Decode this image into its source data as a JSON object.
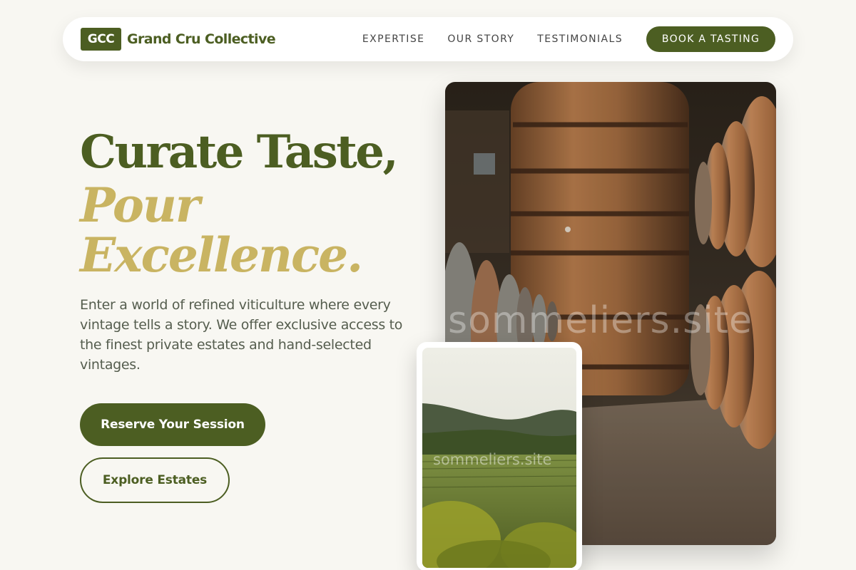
{
  "brand": {
    "badge": "GCC",
    "name": "Grand Cru Collective",
    "color": "#4c5e22",
    "accent": "#c9b462"
  },
  "nav": {
    "links": [
      "EXPERTISE",
      "OUR STORY",
      "TESTIMONIALS"
    ],
    "cta": "BOOK A TASTING"
  },
  "hero": {
    "line1": "Curate Taste,",
    "line2": "Pour",
    "line3": "Excellence.",
    "description": "Enter a world of refined viticulture where every vintage tells a story. We offer exclusive access to the finest private estates and hand-selected vintages.",
    "primary_button": "Reserve Your Session",
    "secondary_button": "Explore Estates"
  },
  "images": {
    "main": "wine-barrel-cellar-photo",
    "secondary": "vineyard-hills-photo",
    "watermark": "sommeliers.site"
  }
}
